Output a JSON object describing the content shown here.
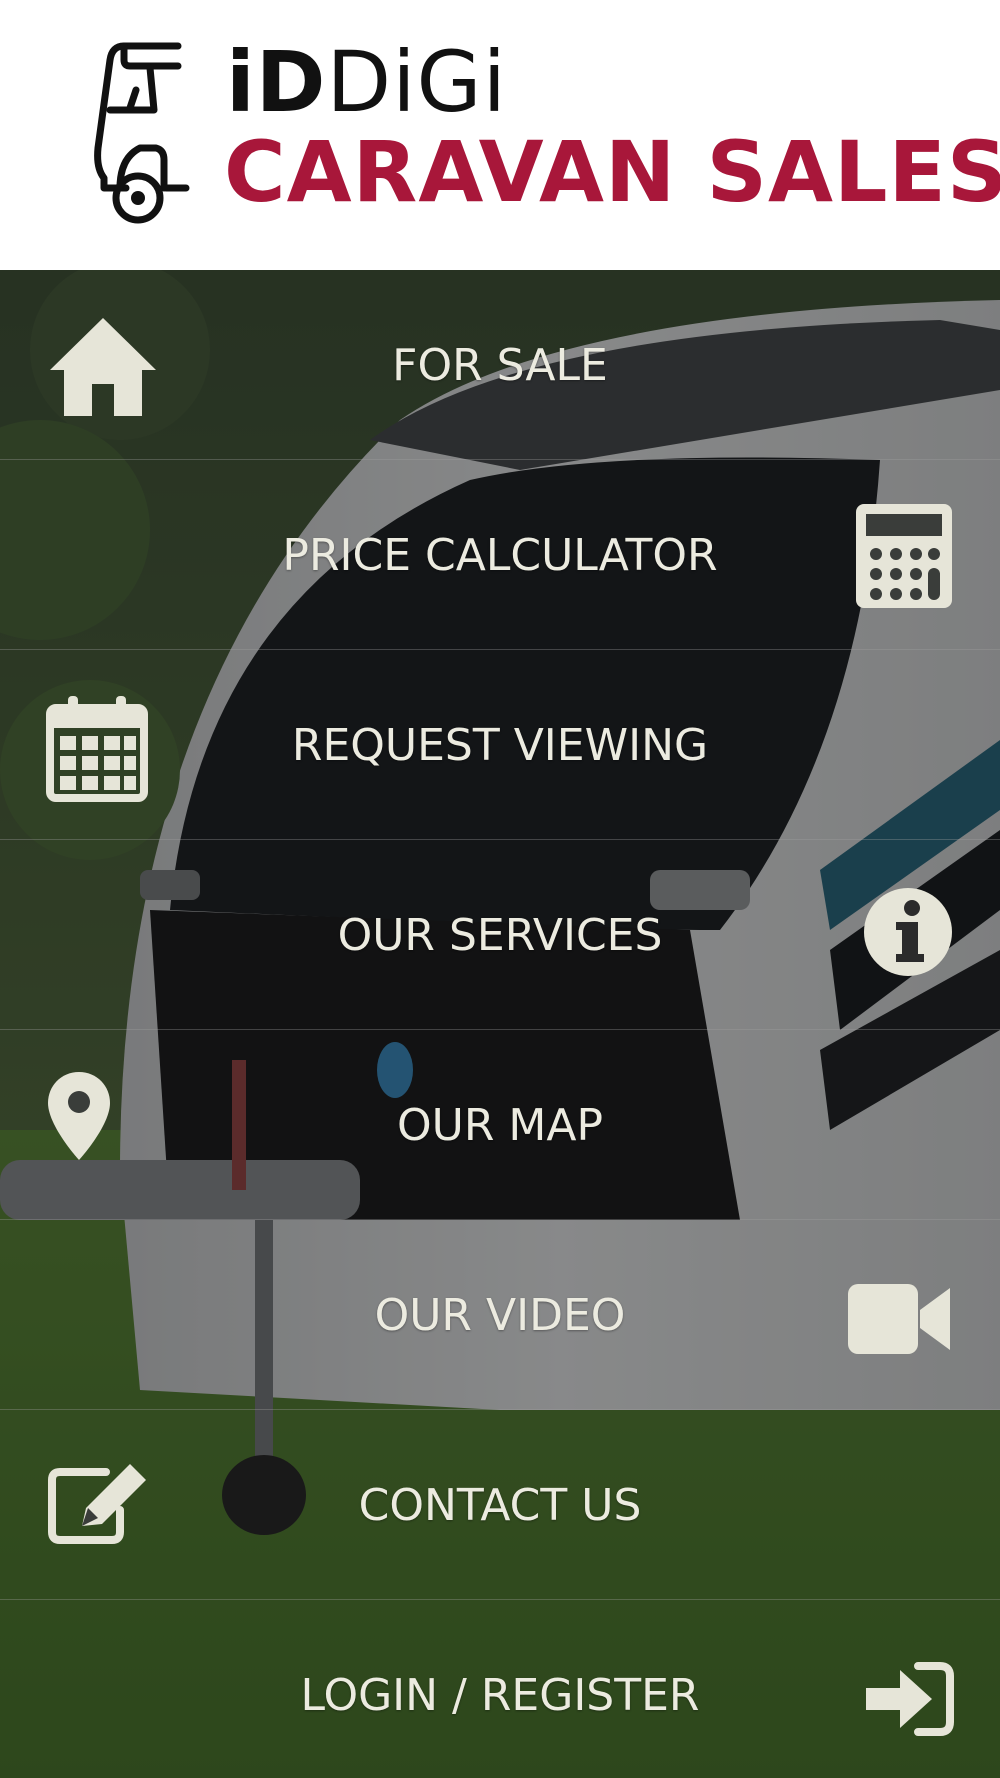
{
  "header": {
    "brand_prefix": "iD",
    "brand_suffix": "DiGi",
    "brand_tagline": "CARAVAN SALES",
    "logo_icon": "caravan-icon",
    "colors": {
      "brand_red": "#a8173a",
      "brand_black": "#111111"
    }
  },
  "menu": {
    "text_color": "#ecebe0",
    "items": [
      {
        "label": "FOR SALE",
        "icon": "home-icon",
        "icon_side": "left"
      },
      {
        "label": "PRICE CALCULATOR",
        "icon": "calculator-icon",
        "icon_side": "right"
      },
      {
        "label": "REQUEST VIEWING",
        "icon": "calendar-icon",
        "icon_side": "left"
      },
      {
        "label": "OUR SERVICES",
        "icon": "info-icon",
        "icon_side": "right"
      },
      {
        "label": "OUR MAP",
        "icon": "map-pin-icon",
        "icon_side": "left"
      },
      {
        "label": "OUR VIDEO",
        "icon": "video-camera-icon",
        "icon_side": "right"
      },
      {
        "label": "CONTACT US",
        "icon": "edit-icon",
        "icon_side": "left"
      },
      {
        "label": "LOGIN / REGISTER",
        "icon": "sign-in-icon",
        "icon_side": "right"
      }
    ]
  }
}
